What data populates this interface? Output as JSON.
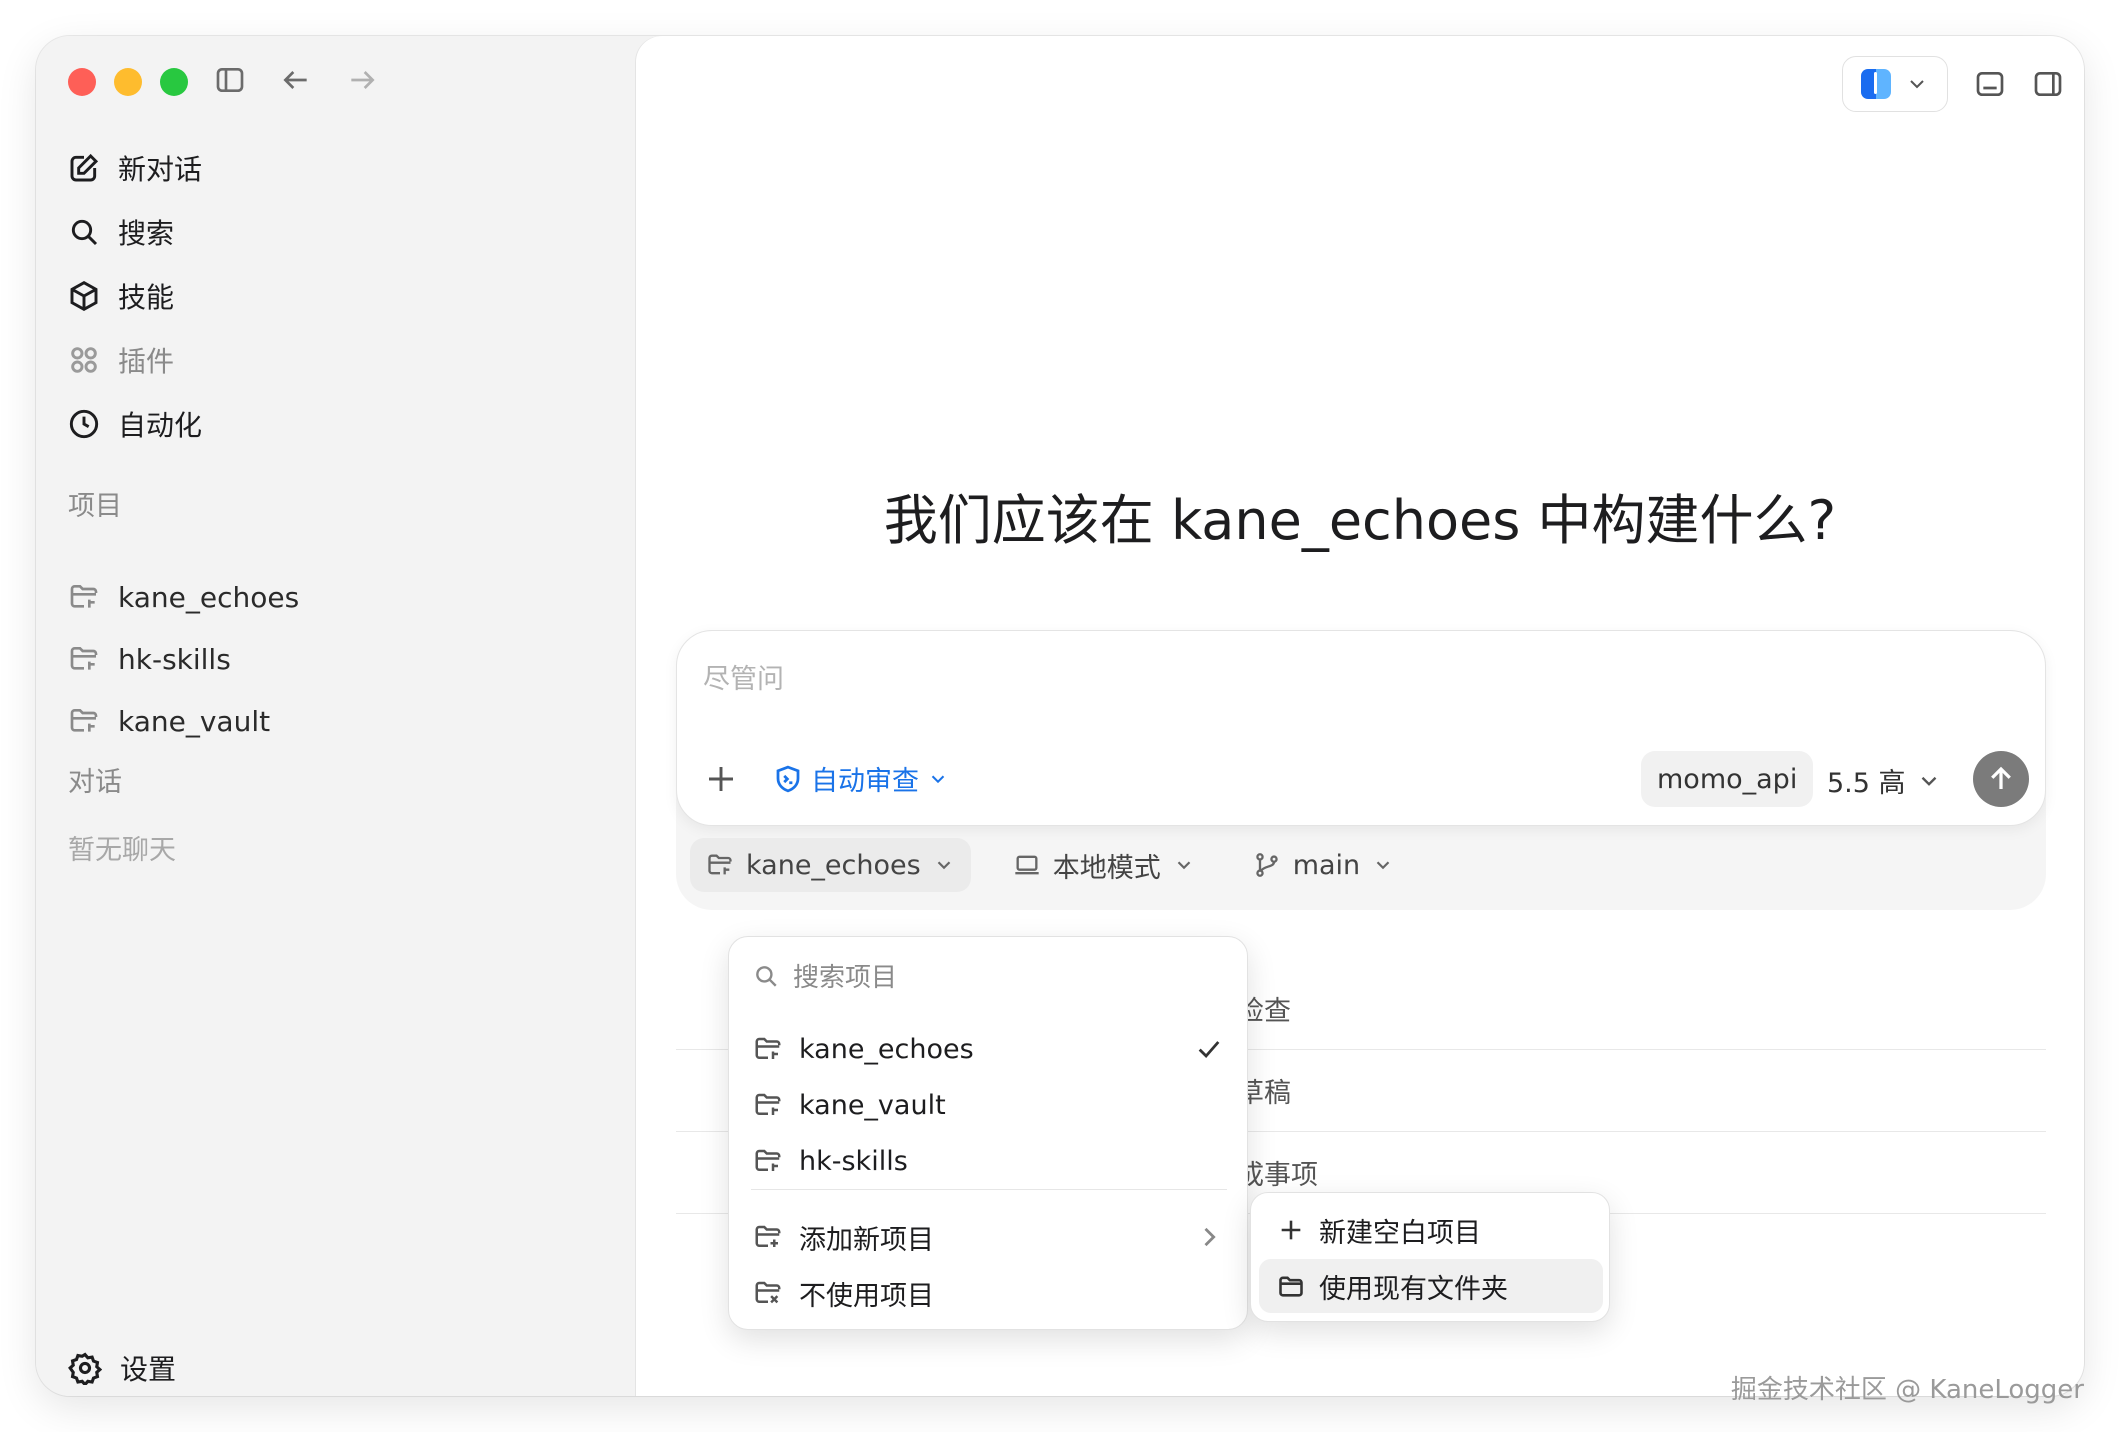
{
  "sidebar": {
    "nav": [
      {
        "label": "新对话",
        "icon": "compose-icon"
      },
      {
        "label": "搜索",
        "icon": "search-icon"
      },
      {
        "label": "技能",
        "icon": "cube-icon"
      },
      {
        "label": "插件",
        "icon": "grid-icon"
      },
      {
        "label": "自动化",
        "icon": "clock-icon"
      }
    ],
    "projects_title": "项目",
    "projects": [
      "kane_echoes",
      "hk-skills",
      "kane_vault"
    ],
    "chats_title": "对话",
    "chats_empty": "暂无聊天",
    "settings_label": "设置"
  },
  "main": {
    "headline": "我们应该在 kane_echoes 中构建什么?",
    "composer": {
      "placeholder": "尽管问",
      "review_label": "自动审查",
      "model": "momo_api",
      "effort": "5.5 高"
    },
    "bar": {
      "project": "kane_echoes",
      "mode": "本地模式",
      "branch": "main"
    },
    "suggestions": [
      "齐检查",
      "选草稿",
      "完成事项"
    ]
  },
  "dropdown": {
    "search_placeholder": "搜索项目",
    "projects": [
      "kane_echoes",
      "kane_vault",
      "hk-skills"
    ],
    "selected": "kane_echoes",
    "add_new": "添加新项目",
    "no_project": "不使用项目"
  },
  "submenu": {
    "new_blank": "新建空白项目",
    "use_existing": "使用现有文件夹"
  },
  "watermark": "掘金技术社区 @ KaneLogger",
  "colors": {
    "accent": "#1a73e8",
    "send": "#7b7b7b",
    "close": "#fe5f57",
    "minimize": "#febc2e",
    "zoom": "#28c840"
  }
}
